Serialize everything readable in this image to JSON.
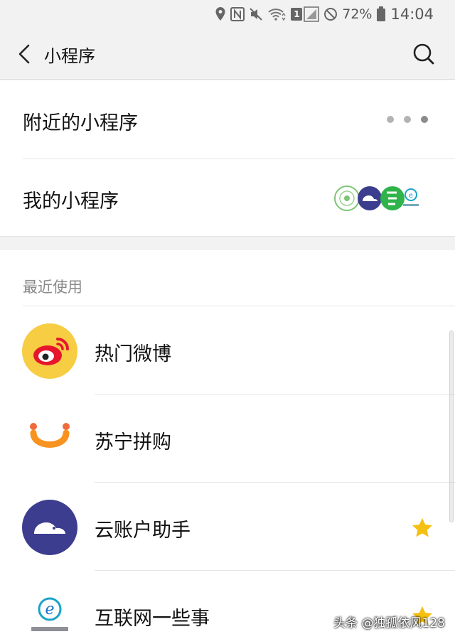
{
  "status": {
    "battery": "72%",
    "time": "14:04",
    "sim_badge": "1"
  },
  "nav": {
    "title": "小程序"
  },
  "nearby": {
    "label": "附近的小程序"
  },
  "mine": {
    "label": "我的小程序"
  },
  "recent": {
    "section_label": "最近使用",
    "apps": [
      {
        "name": "热门微博",
        "icon": "weibo-icon",
        "starred": false
      },
      {
        "name": "苏宁拼购",
        "icon": "suning-icon",
        "starred": false
      },
      {
        "name": "云账户助手",
        "icon": "cloud-account-icon",
        "starred": true
      },
      {
        "name": "互联网一些事",
        "icon": "internet-things-icon",
        "starred": true
      }
    ]
  },
  "watermark": "头条 @独孤依风128",
  "colors": {
    "star": "#f6c012",
    "weibo_bg": "#f7cd43",
    "weibo_red": "#e6162d",
    "cloud_bg": "#3c3d8e",
    "suning_orange": "#f7931e"
  }
}
